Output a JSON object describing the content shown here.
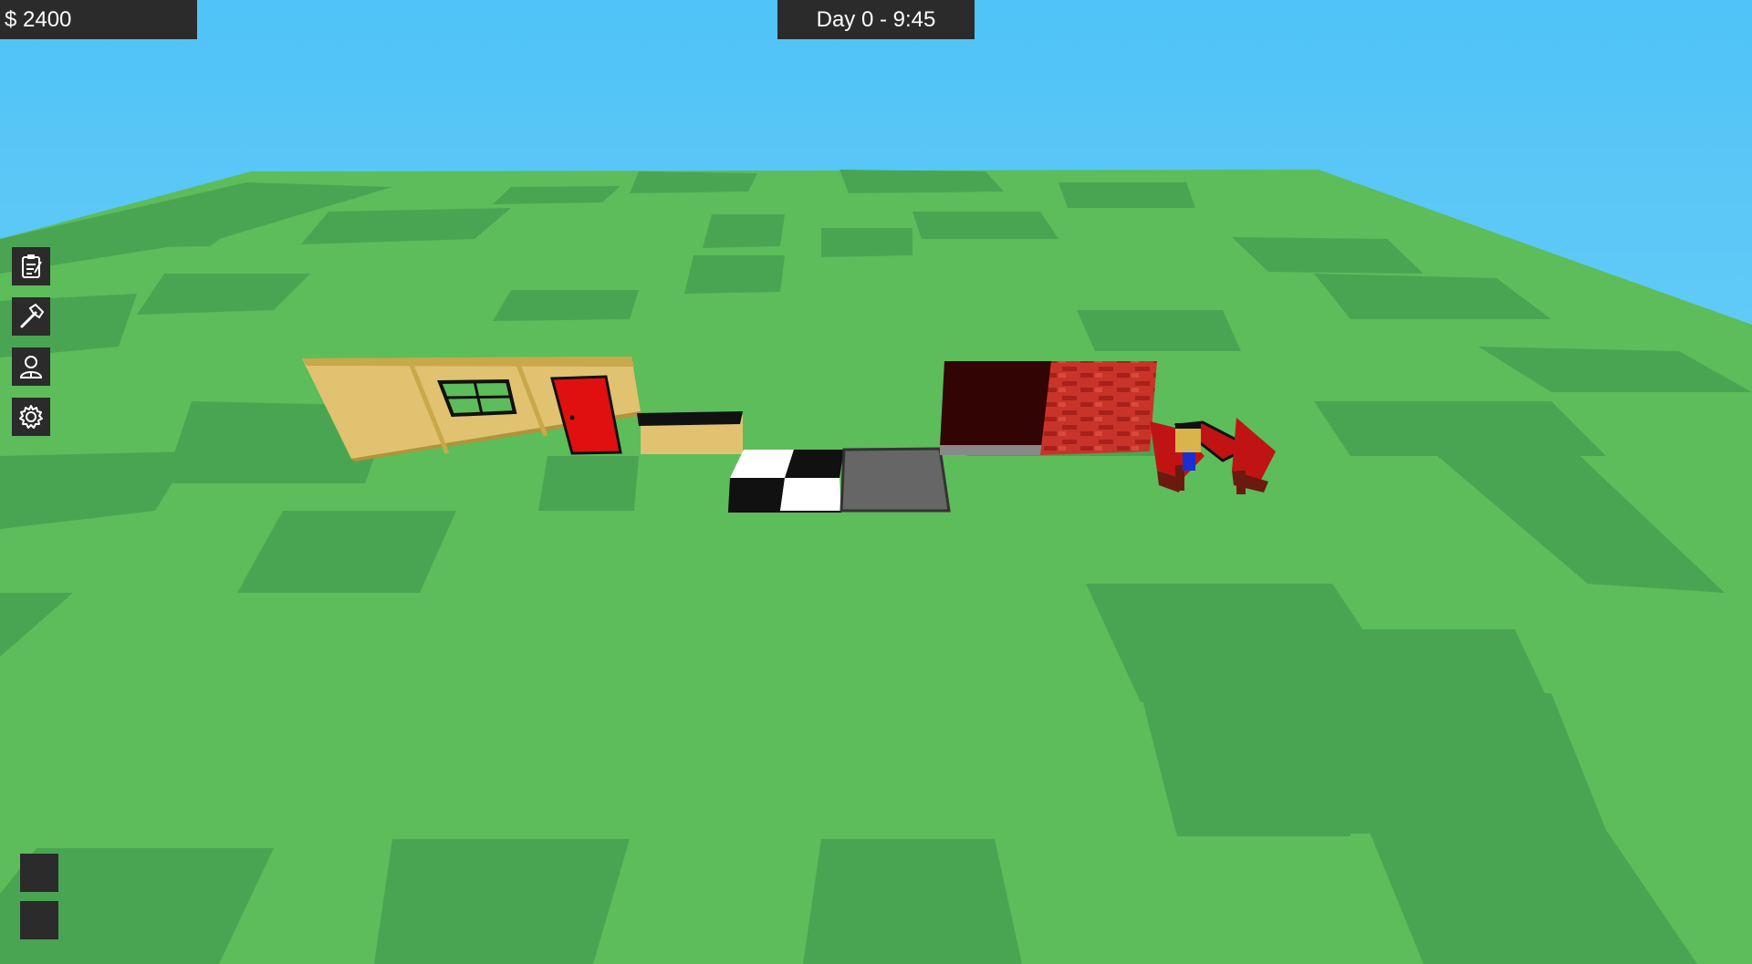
{
  "hud": {
    "money": "$ 2400",
    "clock": "Day 0 - 9:45"
  },
  "toolbar": {
    "items": [
      {
        "name": "tasks",
        "icon": "clipboard-icon"
      },
      {
        "name": "build",
        "icon": "hammer-icon"
      },
      {
        "name": "staff",
        "icon": "person-icon"
      },
      {
        "name": "settings",
        "icon": "gear-icon"
      }
    ]
  },
  "quick_slots": [
    {
      "name": "slot-1"
    },
    {
      "name": "slot-2"
    }
  ],
  "colors": {
    "sky_top": "#4fc3f7",
    "sky_bottom": "#83d6f8",
    "grass_light": "#5cbd5a",
    "grass_dark": "#4aa552",
    "hud_bg": "#2b2b2b",
    "wall": "#e0c270",
    "door": "#e01010",
    "brick": "#c8342a",
    "dark_wall": "#320404",
    "concrete": "#666666"
  },
  "scene_objects": [
    {
      "name": "wall-segment",
      "icon": "wall"
    },
    {
      "name": "window",
      "icon": "window"
    },
    {
      "name": "door",
      "icon": "door"
    },
    {
      "name": "counter",
      "icon": "counter"
    },
    {
      "name": "checkered-floor-tile",
      "icon": "floor-checker"
    },
    {
      "name": "concrete-floor-tile",
      "icon": "floor-concrete"
    },
    {
      "name": "dark-wall-block",
      "icon": "wall-dark"
    },
    {
      "name": "brick-wall-block",
      "icon": "wall-brick"
    },
    {
      "name": "diner-booth",
      "icon": "booth"
    },
    {
      "name": "customer",
      "icon": "person"
    }
  ]
}
